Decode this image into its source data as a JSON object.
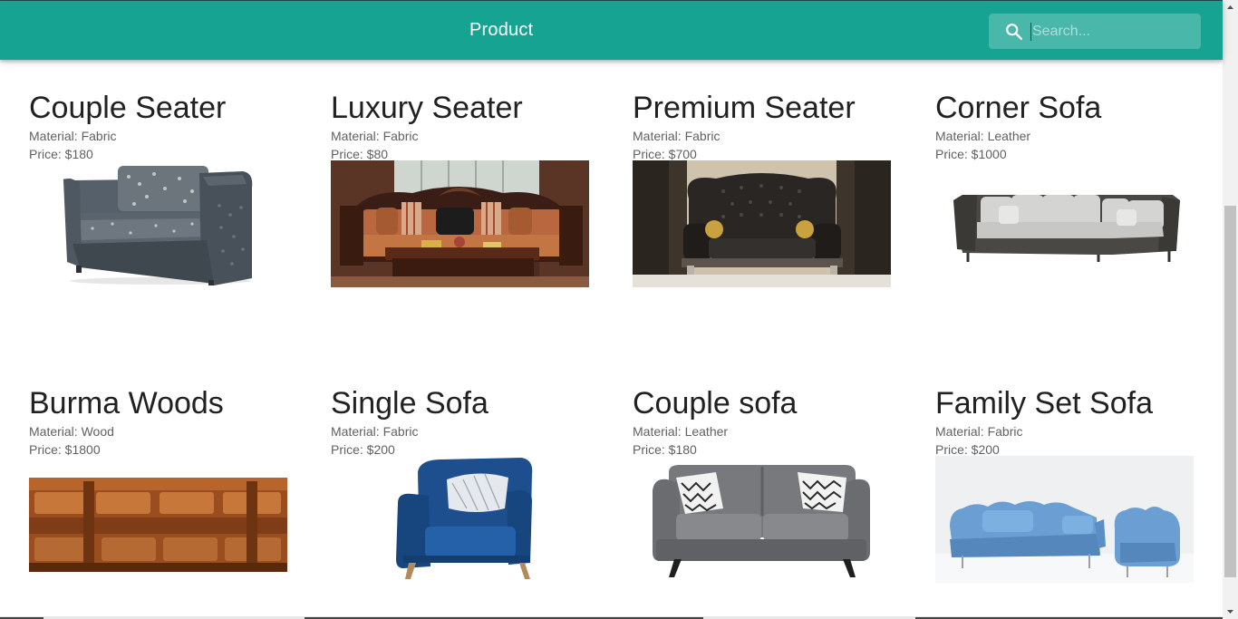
{
  "appbar": {
    "title": "Product",
    "search": {
      "placeholder": "Search...",
      "value": "",
      "icon": "search-icon"
    },
    "color": "#17a392"
  },
  "products": [
    {
      "title": "Couple Seater",
      "material": "Material: Fabric",
      "price": "Price: $180",
      "image": "grey couple seater sofa"
    },
    {
      "title": "Luxury Seater",
      "material": "Material: Fabric",
      "price": "Price: $80",
      "image": "carved wood luxury sofa"
    },
    {
      "title": "Premium Seater",
      "material": "Material: Fabric",
      "price": "Price: $700",
      "image": "black tufted premium sofa"
    },
    {
      "title": "Corner Sofa",
      "material": "Material: Leather",
      "price": "Price: $1000",
      "image": "grey corner sofa"
    },
    {
      "title": "Burma Woods",
      "material": "Material: Wood",
      "price": "Price: $1800",
      "image": "carved wooden bench"
    },
    {
      "title": "Single Sofa",
      "material": "Material: Fabric",
      "price": "Price: $200",
      "image": "blue armchair"
    },
    {
      "title": "Couple sofa",
      "material": "Material: Leather",
      "price": "Price: $180",
      "image": "grey couple sofa"
    },
    {
      "title": "Family Set Sofa",
      "material": "Material: Fabric",
      "price": "Price: $200",
      "image": "blue family sofa set"
    }
  ]
}
